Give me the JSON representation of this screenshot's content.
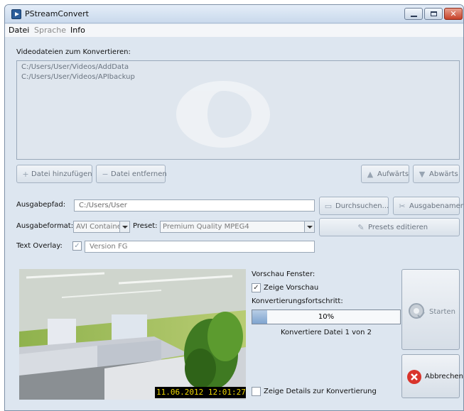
{
  "window": {
    "title": "PStreamConvert"
  },
  "menu": {
    "items": [
      "Datei",
      "Sprache",
      "Info"
    ]
  },
  "files": {
    "section_label": "Videodateien zum Konvertieren:",
    "items": [
      "C:/Users/User/Videos/AddData",
      "C:/Users/User/Videos/APIbackup"
    ]
  },
  "buttons": {
    "add_file": "Datei hinzufügen",
    "remove_file": "Datei entfernen",
    "up": "Aufwärts",
    "down": "Abwärts",
    "browse": "Durchsuchen...",
    "output_names": "Ausgabenamen",
    "edit_presets": "Presets editieren",
    "start": "Starten",
    "cancel": "Abbrechen"
  },
  "output": {
    "path_label": "Ausgabepfad:",
    "path_value": "C:/Users/User",
    "format_label": "Ausgabeformat:",
    "format_value": "AVI Containe",
    "preset_label": "Preset:",
    "preset_value": "Premium Quality MPEG4",
    "overlay_label": "Text Overlay:",
    "overlay_value": "Version FG"
  },
  "preview": {
    "window_label": "Vorschau Fenster:",
    "show_preview_label": "Zeige Vorschau",
    "timestamp": "11.06.2012   12:01:27"
  },
  "progress": {
    "label": "Konvertierungsfortschritt:",
    "value_text": "10%",
    "fraction": 0.1,
    "status": "Konvertiere Datei 1 von 2"
  },
  "details_label": "Zeige Details zur Konvertierung",
  "colors": {
    "cancel_red": "#d9342b",
    "progress_fill": "#8fb0d6"
  },
  "icons": {
    "start": "gear-check-icon",
    "cancel": "cancel-x-icon"
  }
}
